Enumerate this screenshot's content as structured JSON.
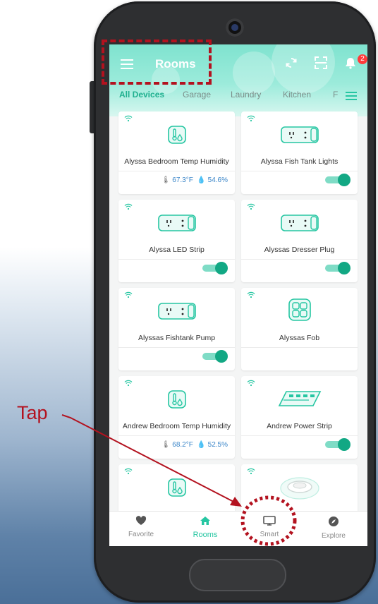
{
  "header": {
    "title": "Rooms",
    "notification_count": "2"
  },
  "tabs": [
    {
      "label": "All Devices",
      "active": true
    },
    {
      "label": "Garage",
      "active": false
    },
    {
      "label": "Laundry",
      "active": false
    },
    {
      "label": "Kitchen",
      "active": false
    },
    {
      "label": "F",
      "active": false
    }
  ],
  "devices": [
    {
      "name": "Alyssa Bedroom Temp Humidity",
      "temp": "67.3°F",
      "humidity": "54.6%"
    },
    {
      "name": "Alyssa Fish Tank Lights",
      "switch_on": true
    },
    {
      "name": "Alyssa LED Strip",
      "switch_on": true
    },
    {
      "name": "Alyssas Dresser Plug",
      "switch_on": true
    },
    {
      "name": "Alyssas Fishtank Pump",
      "switch_on": true
    },
    {
      "name": "Alyssas Fob"
    },
    {
      "name": "Andrew Bedroom Temp Humidity",
      "temp": "68.2°F",
      "humidity": "52.5%"
    },
    {
      "name": "Andrew Power Strip",
      "switch_on": true
    }
  ],
  "bottom_nav": [
    {
      "label": "Favorite",
      "icon": "heart-icon"
    },
    {
      "label": "Rooms",
      "icon": "home-icon",
      "active": true
    },
    {
      "label": "Smart",
      "icon": "monitor-icon"
    },
    {
      "label": "Explore",
      "icon": "compass-icon"
    }
  ],
  "annotation": {
    "tap_label": "Tap"
  },
  "colors": {
    "accent": "#26c6a2",
    "annotation": "#b3121f"
  }
}
